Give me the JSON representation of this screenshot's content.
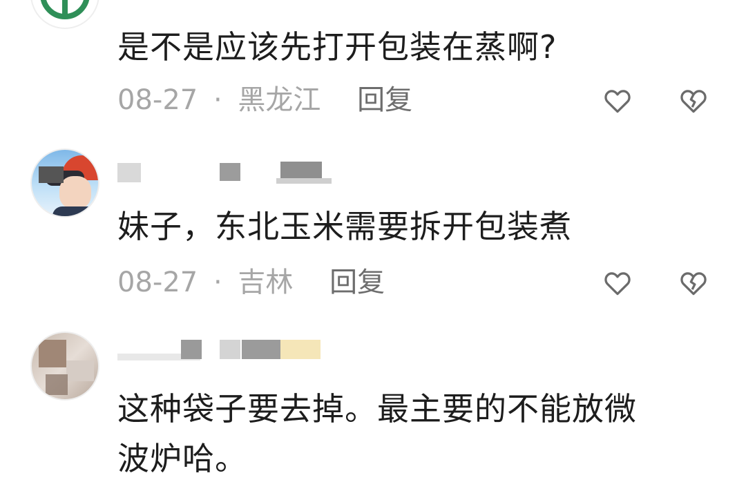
{
  "comments": [
    {
      "text": "是不是应该先打开包装在蒸啊?",
      "date": "08-27",
      "separator": "·",
      "location": "黑龙江",
      "reply_label": "回复"
    },
    {
      "text": "妹子，东北玉米需要拆开包装煮",
      "date": "08-27",
      "separator": "·",
      "location": "吉林",
      "reply_label": "回复"
    },
    {
      "text_line1": "这种袋子要去掉。最主要的不能放微",
      "text_line2": "波炉哈。"
    }
  ],
  "icons": {
    "like": "heart-outline-icon",
    "dislike": "broken-heart-icon"
  },
  "colors": {
    "text": "#1d1d1d",
    "meta": "#a6a6a6",
    "reply": "#6d6d6d",
    "icon": "#6b6b6b",
    "avatar1_accent": "#2f8f58"
  }
}
